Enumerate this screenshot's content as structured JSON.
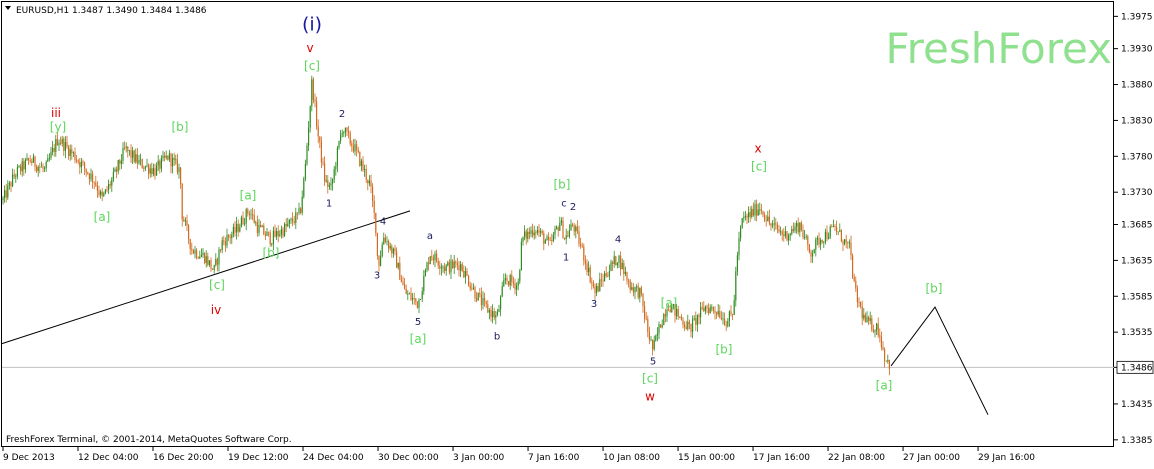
{
  "header": {
    "symbol_text": "EURUSD,H1  1.3487 1.3490 1.3484 1.3486"
  },
  "watermark": "FreshForex",
  "footer": "FreshForex Terminal, © 2001-2014, MetaQuotes Software Corp.",
  "colors": {
    "bull": "#2e8b22",
    "bear": "#d2691e",
    "label_green": "#5cd65c",
    "label_red": "#e00000",
    "label_blue": "#1a1aa0",
    "watermark": "#8fe08f"
  },
  "chart_data": {
    "type": "candlestick",
    "symbol": "EURUSD",
    "timeframe": "H1",
    "last_price": "1.3486",
    "ylim": [
      1.3375,
      1.3995
    ],
    "y_ticks": [
      "1.3975",
      "1.3930",
      "1.3880",
      "1.3830",
      "1.3780",
      "1.3730",
      "1.3685",
      "1.3635",
      "1.3585",
      "1.3535",
      "1.3486",
      "1.3435",
      "1.3385"
    ],
    "x_ticks": [
      "9 Dec 2013",
      "12 Dec 04:00",
      "16 Dec 20:00",
      "19 Dec 12:00",
      "24 Dec 04:00",
      "30 Dec 00:00",
      "3 Jan 00:00",
      "7 Jan 16:00",
      "10 Jan 08:00",
      "15 Jan 00:00",
      "17 Jan 16:00",
      "22 Jan 08:00",
      "27 Jan 00:00",
      "29 Jan 16:00"
    ],
    "price_path": [
      [
        0,
        1.371
      ],
      [
        15,
        1.3755
      ],
      [
        30,
        1.3775
      ],
      [
        45,
        1.376
      ],
      [
        58,
        1.3805
      ],
      [
        75,
        1.378
      ],
      [
        95,
        1.3745
      ],
      [
        102,
        1.372
      ],
      [
        115,
        1.3755
      ],
      [
        125,
        1.379
      ],
      [
        140,
        1.377
      ],
      [
        155,
        1.376
      ],
      [
        168,
        1.378
      ],
      [
        180,
        1.376
      ],
      [
        182,
        1.37
      ],
      [
        192,
        1.365
      ],
      [
        205,
        1.364
      ],
      [
        214,
        1.362
      ],
      [
        222,
        1.366
      ],
      [
        235,
        1.3675
      ],
      [
        249,
        1.3705
      ],
      [
        258,
        1.368
      ],
      [
        271,
        1.3665
      ],
      [
        285,
        1.368
      ],
      [
        300,
        1.37
      ],
      [
        305,
        1.376
      ],
      [
        312,
        1.3885
      ],
      [
        318,
        1.381
      ],
      [
        325,
        1.3745
      ],
      [
        331,
        1.3735
      ],
      [
        342,
        1.382
      ],
      [
        355,
        1.379
      ],
      [
        370,
        1.374
      ],
      [
        376,
        1.368
      ],
      [
        378,
        1.3625
      ],
      [
        384,
        1.367
      ],
      [
        395,
        1.364
      ],
      [
        405,
        1.359
      ],
      [
        418,
        1.3575
      ],
      [
        430,
        1.3645
      ],
      [
        445,
        1.3625
      ],
      [
        460,
        1.363
      ],
      [
        475,
        1.359
      ],
      [
        485,
        1.357
      ],
      [
        497,
        1.3555
      ],
      [
        505,
        1.361
      ],
      [
        518,
        1.36
      ],
      [
        522,
        1.3665
      ],
      [
        535,
        1.368
      ],
      [
        550,
        1.3655
      ],
      [
        560,
        1.369
      ],
      [
        565,
        1.3665
      ],
      [
        573,
        1.3685
      ],
      [
        582,
        1.365
      ],
      [
        595,
        1.359
      ],
      [
        605,
        1.3615
      ],
      [
        618,
        1.364
      ],
      [
        630,
        1.36
      ],
      [
        640,
        1.359
      ],
      [
        648,
        1.3535
      ],
      [
        653,
        1.351
      ],
      [
        660,
        1.3545
      ],
      [
        668,
        1.3575
      ],
      [
        680,
        1.3555
      ],
      [
        690,
        1.354
      ],
      [
        705,
        1.357
      ],
      [
        718,
        1.3565
      ],
      [
        726,
        1.355
      ],
      [
        733,
        1.356
      ],
      [
        737,
        1.364
      ],
      [
        742,
        1.369
      ],
      [
        760,
        1.371
      ],
      [
        770,
        1.3685
      ],
      [
        785,
        1.367
      ],
      [
        800,
        1.3685
      ],
      [
        810,
        1.3645
      ],
      [
        820,
        1.3665
      ],
      [
        835,
        1.368
      ],
      [
        850,
        1.365
      ],
      [
        855,
        1.359
      ],
      [
        865,
        1.355
      ],
      [
        878,
        1.354
      ],
      [
        885,
        1.35
      ],
      [
        891,
        1.3488
      ]
    ],
    "trendline": {
      "from": [
        0,
        1.3519
      ],
      "to": [
        410,
        1.3704
      ]
    },
    "projection": [
      [
        891,
        1.3488
      ],
      [
        935,
        1.357
      ],
      [
        988,
        1.342
      ]
    ],
    "wave_labels": [
      {
        "text": "(i)",
        "x": 312,
        "y": 1.3955,
        "color": "blue",
        "size": "large"
      },
      {
        "text": "v",
        "x": 310,
        "y": 1.3925,
        "color": "red"
      },
      {
        "text": "[c]",
        "x": 312,
        "y": 1.39,
        "color": "green"
      },
      {
        "text": "iii",
        "x": 56,
        "y": 1.3835,
        "color": "red"
      },
      {
        "text": "[y]",
        "x": 58,
        "y": 1.3815,
        "color": "green"
      },
      {
        "text": "[b]",
        "x": 180,
        "y": 1.3815,
        "color": "green"
      },
      {
        "text": "[a]",
        "x": 102,
        "y": 1.369,
        "color": "green"
      },
      {
        "text": "[a]",
        "x": 248,
        "y": 1.372,
        "color": "green"
      },
      {
        "text": "[b]",
        "x": 271,
        "y": 1.364,
        "color": "green"
      },
      {
        "text": "[c]",
        "x": 217,
        "y": 1.3595,
        "color": "green"
      },
      {
        "text": "iv",
        "x": 216,
        "y": 1.356,
        "color": "red"
      },
      {
        "text": "2",
        "x": 342,
        "y": 1.3835,
        "color": "dark"
      },
      {
        "text": "1",
        "x": 329,
        "y": 1.371,
        "color": "dark"
      },
      {
        "text": "4",
        "x": 383,
        "y": 1.3685,
        "color": "dark"
      },
      {
        "text": "3",
        "x": 377,
        "y": 1.361,
        "color": "dark"
      },
      {
        "text": "a",
        "x": 430,
        "y": 1.3665,
        "color": "dark"
      },
      {
        "text": "5",
        "x": 418,
        "y": 1.3545,
        "color": "dark"
      },
      {
        "text": "[a]",
        "x": 418,
        "y": 1.352,
        "color": "green"
      },
      {
        "text": "b",
        "x": 497,
        "y": 1.3525,
        "color": "dark"
      },
      {
        "text": "[b]",
        "x": 562,
        "y": 1.3735,
        "color": "green"
      },
      {
        "text": "c",
        "x": 564,
        "y": 1.371,
        "color": "dark"
      },
      {
        "text": "2",
        "x": 573,
        "y": 1.3705,
        "color": "dark"
      },
      {
        "text": "1",
        "x": 566,
        "y": 1.3635,
        "color": "dark"
      },
      {
        "text": "4",
        "x": 618,
        "y": 1.366,
        "color": "dark"
      },
      {
        "text": "3",
        "x": 594,
        "y": 1.357,
        "color": "dark"
      },
      {
        "text": "[a]",
        "x": 669,
        "y": 1.357,
        "color": "green"
      },
      {
        "text": "5",
        "x": 653,
        "y": 1.349,
        "color": "dark"
      },
      {
        "text": "[c]",
        "x": 650,
        "y": 1.3465,
        "color": "green"
      },
      {
        "text": "w",
        "x": 650,
        "y": 1.344,
        "color": "red"
      },
      {
        "text": "[b]",
        "x": 724,
        "y": 1.3505,
        "color": "green"
      },
      {
        "text": "x",
        "x": 758,
        "y": 1.3785,
        "color": "red"
      },
      {
        "text": "[c]",
        "x": 759,
        "y": 1.376,
        "color": "green"
      },
      {
        "text": "[b]",
        "x": 934,
        "y": 1.359,
        "color": "green"
      },
      {
        "text": "[a]",
        "x": 884,
        "y": 1.3455,
        "color": "green"
      }
    ]
  }
}
